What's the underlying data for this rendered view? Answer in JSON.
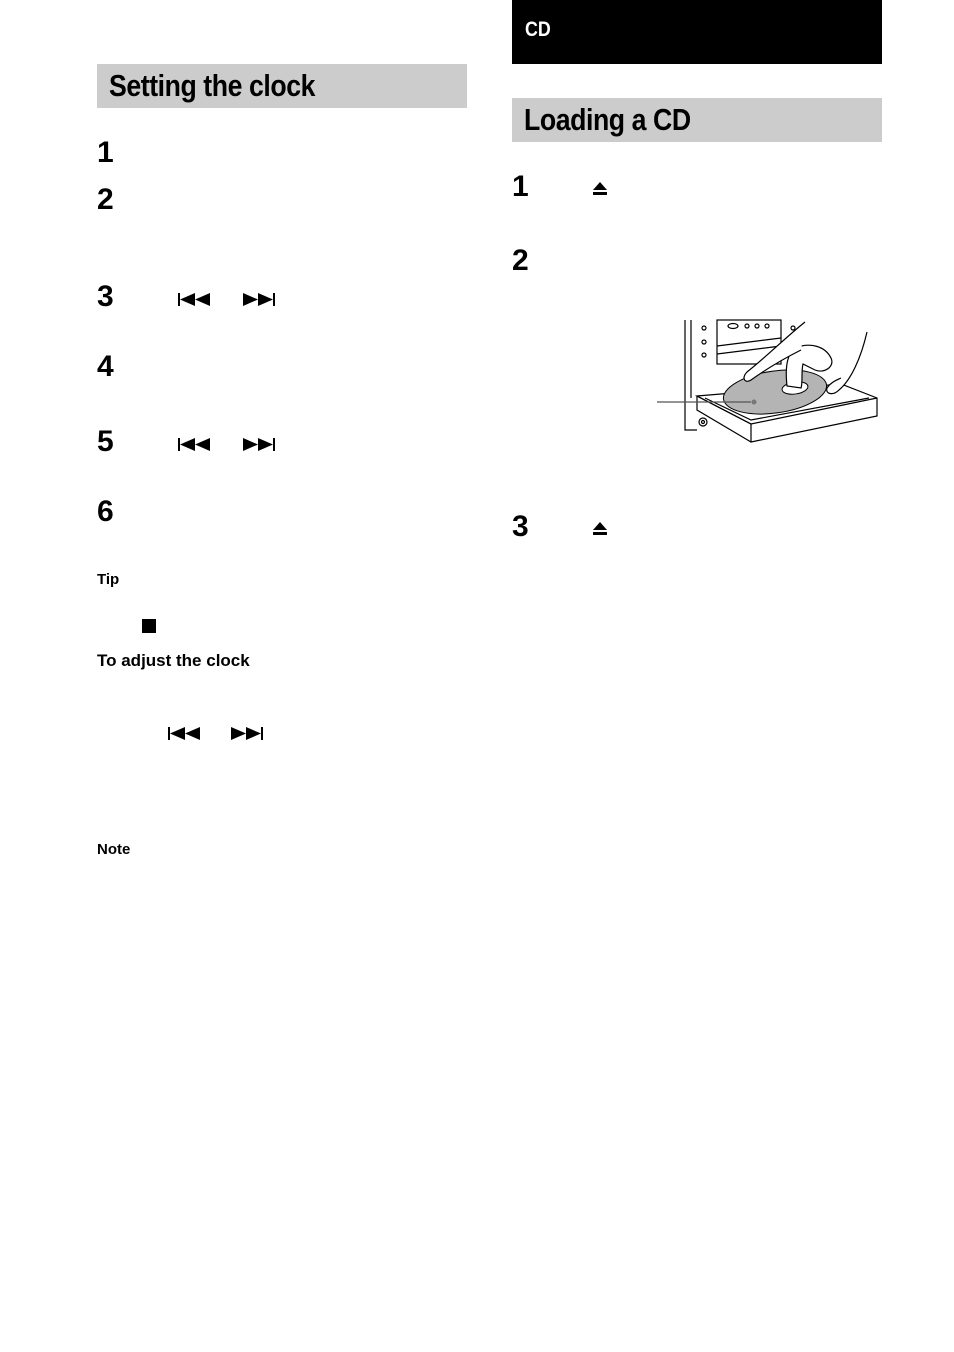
{
  "left_column": {
    "section_title": "Setting the clock",
    "steps": [
      {
        "number": "1"
      },
      {
        "number": "2"
      },
      {
        "number": "3",
        "icons": [
          "previous-track-icon",
          "next-track-icon"
        ]
      },
      {
        "number": "4"
      },
      {
        "number": "5",
        "icons": [
          "previous-track-icon",
          "next-track-icon"
        ]
      },
      {
        "number": "6"
      }
    ],
    "tip_label": "Tip",
    "tip_icon": "stop-icon",
    "adjust_heading": "To adjust the clock",
    "adjust_icons": [
      "previous-track-icon",
      "next-track-icon"
    ],
    "note_label": "Note"
  },
  "right_column": {
    "chapter_label": "CD",
    "section_title": "Loading a CD",
    "steps": [
      {
        "number": "1",
        "icons": [
          "eject-icon"
        ]
      },
      {
        "number": "2"
      },
      {
        "number": "3",
        "icons": [
          "eject-icon"
        ]
      }
    ],
    "illustration": "cd-tray-loading-illustration"
  },
  "colors": {
    "section_bar": "#cccccc",
    "chapter_bar": "#000000",
    "text": "#000000",
    "disc": "#b4b4b4"
  }
}
